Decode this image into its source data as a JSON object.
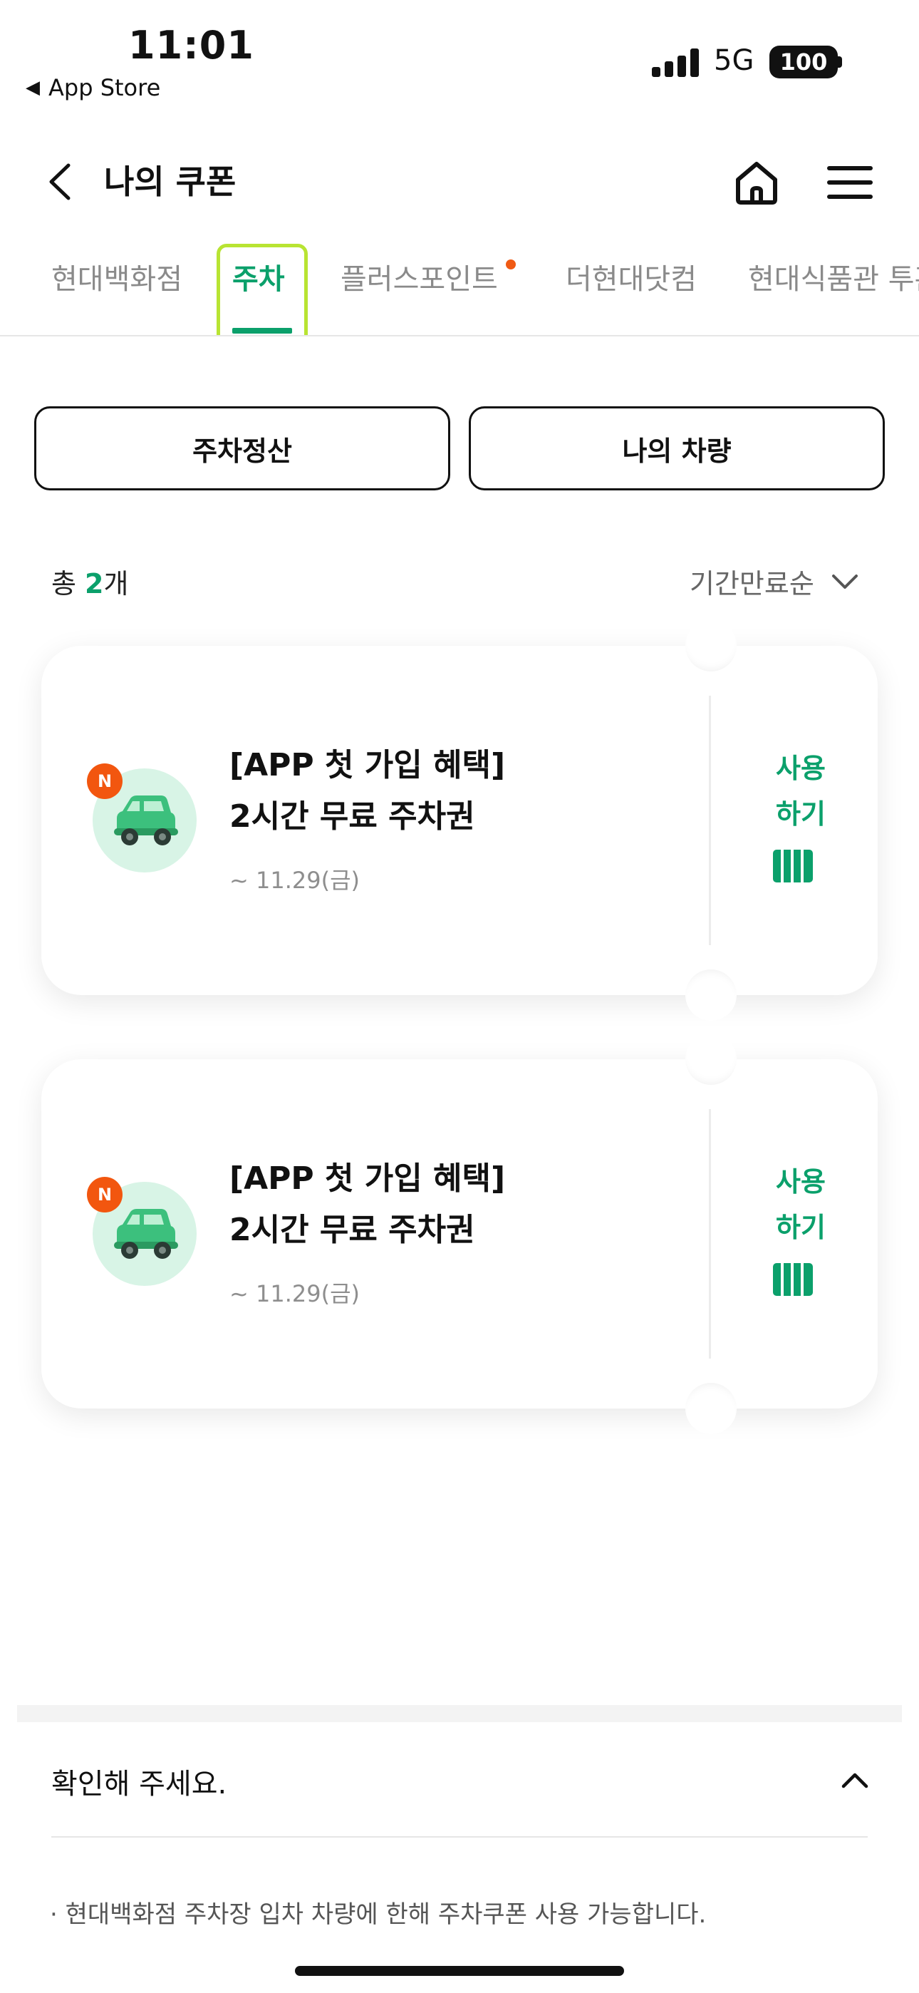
{
  "status_bar": {
    "time": "11:01",
    "back_label": "App Store",
    "network": "5G",
    "battery": "100"
  },
  "header": {
    "title": "나의 쿠폰"
  },
  "tabs": [
    {
      "label": "현대백화점"
    },
    {
      "label": "주차"
    },
    {
      "label": "플러스포인트"
    },
    {
      "label": "더현대닷컴"
    },
    {
      "label": "현대식품관 투홈"
    }
  ],
  "actions": {
    "parking_payment": "주차정산",
    "my_vehicle": "나의 차량"
  },
  "list": {
    "count_prefix": "총 ",
    "count": "2",
    "count_suffix": "개",
    "sort_label": "기간만료순"
  },
  "coupons": [
    {
      "badge": "N",
      "title_line1": "[APP 첫 가입 혜택]",
      "title_line2": "2시간 무료 주차권",
      "date": "~ 11.29(금)",
      "use_line1": "사용",
      "use_line2": "하기"
    },
    {
      "badge": "N",
      "title_line1": "[APP 첫 가입 혜택]",
      "title_line2": "2시간 무료 주차권",
      "date": "~ 11.29(금)",
      "use_line1": "사용",
      "use_line2": "하기"
    }
  ],
  "notice": {
    "title": "확인해 주세요.",
    "text": "· 현대백화점 주차장 입차 차량에 한해 주차쿠폰 사용 가능합니다."
  },
  "colors": {
    "accent": "#0ba06b",
    "badge": "#f2560f",
    "focus": "#b8e433"
  }
}
